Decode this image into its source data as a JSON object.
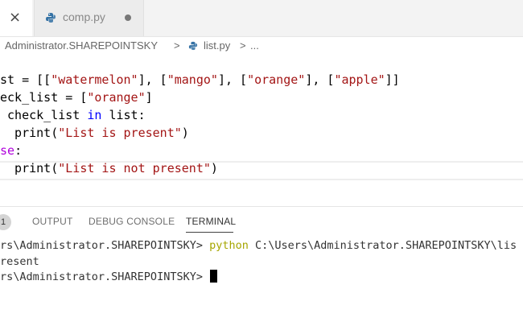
{
  "tabs": {
    "close_symbol": "×",
    "file_tab": {
      "label": "comp.py",
      "icon": "python-icon"
    }
  },
  "breadcrumb": {
    "folder": "Administrator.SHAREPOINTSKY",
    "sep1": ">",
    "file": "list.py",
    "sep2": ">",
    "more": "..."
  },
  "editor": {
    "lines": [
      {
        "pre": "st = [[",
        "s1": "\"watermelon\"",
        "m1": "], [",
        "s2": "\"mango\"",
        "m2": "], [",
        "s3": "\"orange\"",
        "m3": "], [",
        "s4": "\"apple\"",
        "post": "]]"
      },
      {
        "pre": "eck_list = [",
        "s1": "\"orange\"",
        "post": "]"
      },
      {
        "kw1": "",
        "mid": " check_list ",
        "kw2": "in",
        "post": " list:"
      },
      {
        "pre": "  print(",
        "s1": "\"List is present\"",
        "post": ")"
      },
      {
        "kw": "se",
        "post": ":"
      },
      {
        "pre": "  print(",
        "s1": "\"List is not present\"",
        "post": ")"
      }
    ]
  },
  "panel": {
    "badge": "1",
    "tabs": [
      "OUTPUT",
      "DEBUG CONSOLE",
      "TERMINAL"
    ]
  },
  "terminal": {
    "line1_prompt": "rs\\Administrator.SHAREPOINTSKY> ",
    "line1_cmd": "python",
    "line1_args": " C:\\Users\\Administrator.SHAREPOINTSKY\\lis",
    "line2": "resent",
    "line3_prompt": "rs\\Administrator.SHAREPOINTSKY> "
  },
  "colors": {
    "string": "#a31515",
    "keyword_blue": "#0000ff",
    "keyword_purple": "#af00db",
    "terminal_command": "#a6a600"
  }
}
